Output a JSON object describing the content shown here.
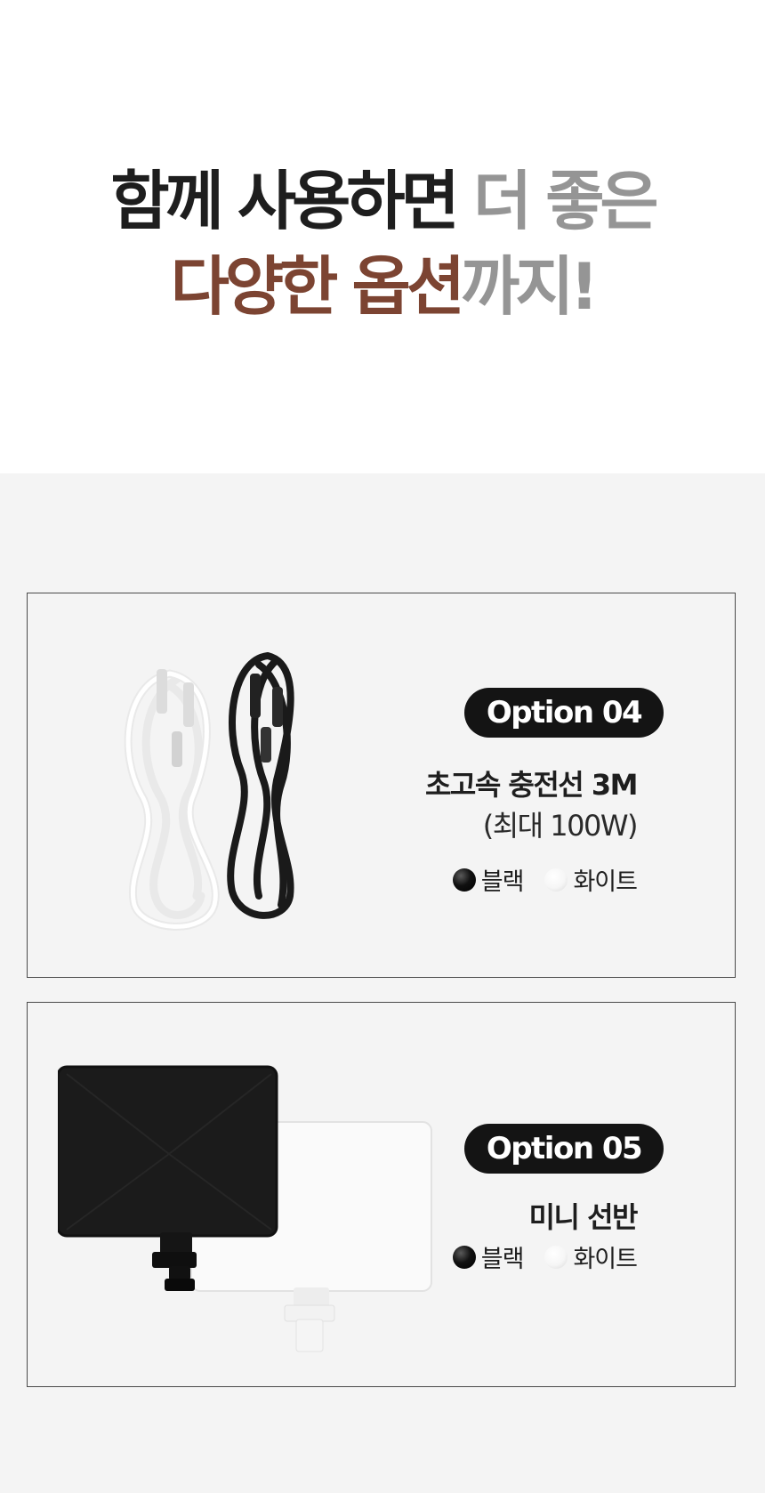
{
  "headline": {
    "line1_part1": "함께 사용하면 ",
    "line1_part2": "더 좋은",
    "line2_part1": "다양한 옵션",
    "line2_part2": "까지!"
  },
  "options": [
    {
      "badge": "Option 04",
      "title": "초고속 충전선 3M",
      "subtitle": "(최대 100W)",
      "colors": [
        {
          "label": "블랙",
          "swatch": "#000000"
        },
        {
          "label": "화이트",
          "swatch": "#ffffff"
        }
      ]
    },
    {
      "badge": "Option 05",
      "title": "미니 선반",
      "colors": [
        {
          "label": "블랙",
          "swatch": "#000000"
        },
        {
          "label": "화이트",
          "swatch": "#ffffff"
        }
      ]
    }
  ],
  "theme": {
    "accent_brown": "#7c4432",
    "muted_gray": "#959595",
    "dark_text": "#1e1e1e",
    "badge_bg": "#141414",
    "panel_bg": "#f4f4f4"
  }
}
